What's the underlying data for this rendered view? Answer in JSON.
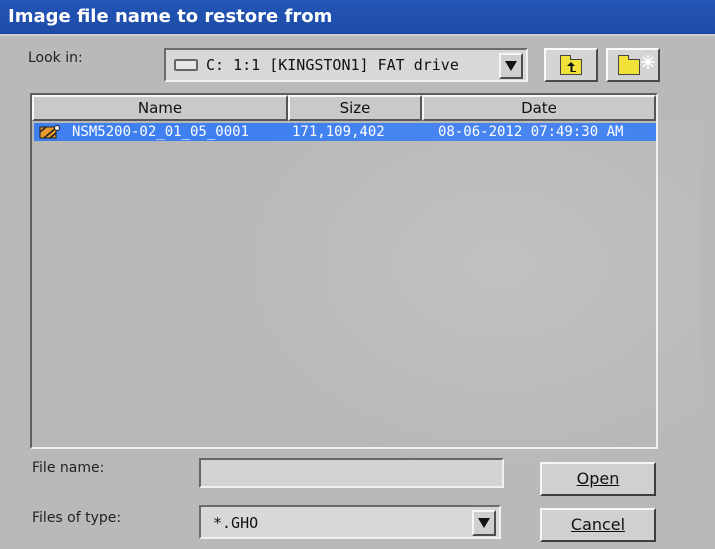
{
  "window": {
    "title": "Image file name to restore from"
  },
  "look_in": {
    "label": "Look in:",
    "value": "C: 1:1 [KINGSTON1] FAT drive"
  },
  "toolbar": {
    "up_icon": "folder-up-icon",
    "new_folder_icon": "new-folder-icon"
  },
  "file_list": {
    "columns": [
      "Name",
      "Size",
      "Date"
    ],
    "rows": [
      {
        "name": "NSM5200-02_01_05_0001",
        "size": "171,109,402",
        "date": "08-06-2012 07:49:30 AM",
        "selected": true
      }
    ]
  },
  "file_name": {
    "label": "File name:",
    "value": ""
  },
  "files_of_type": {
    "label": "Files of type:",
    "value": "*.GHO"
  },
  "buttons": {
    "open": "Open",
    "cancel": "Cancel"
  },
  "colors": {
    "titlebar": "#1e4aa6",
    "selection": "#3f7ff0",
    "background": "#b9b9b9"
  }
}
